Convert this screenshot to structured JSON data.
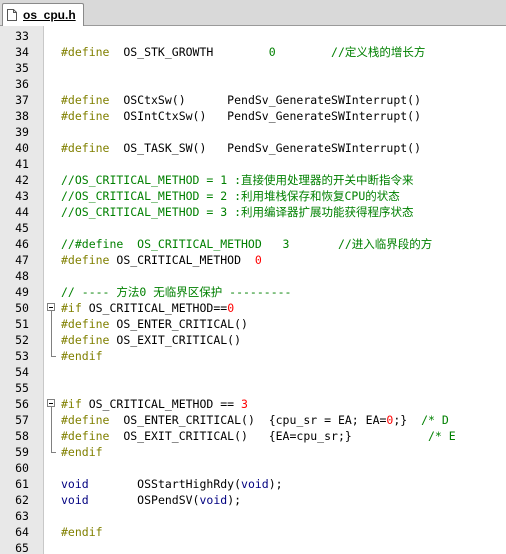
{
  "tab": {
    "label": "os_cpu.h",
    "icon": "file-icon"
  },
  "lines": [
    {
      "n": "33",
      "parts": []
    },
    {
      "n": "34",
      "parts": [
        [
          "kw",
          "#define"
        ],
        [
          "",
          "  OS_STK_GROWTH        "
        ],
        [
          "ct",
          "0"
        ],
        [
          "",
          "        "
        ],
        [
          "cm",
          "//定义栈的增长方"
        ]
      ]
    },
    {
      "n": "35",
      "parts": []
    },
    {
      "n": "36",
      "parts": []
    },
    {
      "n": "37",
      "parts": [
        [
          "kw",
          "#define"
        ],
        [
          "",
          "  OSCtxSw()      PendSv_GenerateSWInterrupt()"
        ]
      ]
    },
    {
      "n": "38",
      "parts": [
        [
          "kw",
          "#define"
        ],
        [
          "",
          "  OSIntCtxSw()   PendSv_GenerateSWInterrupt()"
        ]
      ]
    },
    {
      "n": "39",
      "parts": []
    },
    {
      "n": "40",
      "parts": [
        [
          "kw",
          "#define"
        ],
        [
          "",
          "  OS_TASK_SW()   PendSv_GenerateSWInterrupt()"
        ]
      ]
    },
    {
      "n": "41",
      "parts": []
    },
    {
      "n": "42",
      "parts": [
        [
          "cm",
          "//OS_CRITICAL_METHOD = 1 :直接使用处理器的开关中断指令来"
        ]
      ]
    },
    {
      "n": "43",
      "parts": [
        [
          "cm",
          "//OS_CRITICAL_METHOD = 2 :利用堆栈保存和恢复CPU的状态"
        ]
      ]
    },
    {
      "n": "44",
      "parts": [
        [
          "cm",
          "//OS_CRITICAL_METHOD = 3 :利用编译器扩展功能获得程序状态"
        ]
      ]
    },
    {
      "n": "45",
      "parts": []
    },
    {
      "n": "46",
      "parts": [
        [
          "cm",
          "//#define  OS_CRITICAL_METHOD   3       //进入临界段的方"
        ]
      ]
    },
    {
      "n": "47",
      "parts": [
        [
          "kw",
          "#define"
        ],
        [
          "",
          " OS_CRITICAL_METHOD  "
        ],
        [
          "nm",
          "0"
        ]
      ]
    },
    {
      "n": "48",
      "parts": []
    },
    {
      "n": "49",
      "parts": [
        [
          "cm",
          "// ---- 方法0 无临界区保护 ---------"
        ]
      ]
    },
    {
      "n": "50",
      "parts": [
        [
          "kw",
          "#if"
        ],
        [
          "",
          " OS_CRITICAL_METHOD=="
        ],
        [
          "nm",
          "0"
        ]
      ],
      "fold": "start"
    },
    {
      "n": "51",
      "parts": [
        [
          "kw",
          "#define"
        ],
        [
          "",
          " OS_ENTER_CRITICAL()"
        ]
      ]
    },
    {
      "n": "52",
      "parts": [
        [
          "kw",
          "#define"
        ],
        [
          "",
          " OS_EXIT_CRITICAL()"
        ]
      ]
    },
    {
      "n": "53",
      "parts": [
        [
          "kw",
          "#endif"
        ]
      ]
    },
    {
      "n": "54",
      "parts": []
    },
    {
      "n": "55",
      "parts": []
    },
    {
      "n": "56",
      "parts": [
        [
          "kw",
          "#if"
        ],
        [
          "",
          " OS_CRITICAL_METHOD == "
        ],
        [
          "nm",
          "3"
        ]
      ],
      "fold": "start"
    },
    {
      "n": "57",
      "parts": [
        [
          "kw",
          "#define"
        ],
        [
          "",
          "  OS_ENTER_CRITICAL()  {cpu_sr = EA; EA="
        ],
        [
          "nm",
          "0"
        ],
        [
          "",
          ";}  "
        ],
        [
          "cm",
          "/* D"
        ]
      ]
    },
    {
      "n": "58",
      "parts": [
        [
          "kw",
          "#define"
        ],
        [
          "",
          "  OS_EXIT_CRITICAL()   {EA=cpu_sr;}           "
        ],
        [
          "cm",
          "/* E"
        ]
      ]
    },
    {
      "n": "59",
      "parts": [
        [
          "kw",
          "#endif"
        ]
      ]
    },
    {
      "n": "60",
      "parts": []
    },
    {
      "n": "61",
      "parts": [
        [
          "ty",
          "void"
        ],
        [
          "",
          "       OSStartHighRdy("
        ],
        [
          "ty",
          "void"
        ],
        [
          "",
          ");"
        ]
      ]
    },
    {
      "n": "62",
      "parts": [
        [
          "ty",
          "void"
        ],
        [
          "",
          "       OSPendSV("
        ],
        [
          "ty",
          "void"
        ],
        [
          "",
          ");"
        ]
      ]
    },
    {
      "n": "63",
      "parts": []
    },
    {
      "n": "64",
      "parts": [
        [
          "kw",
          "#endif"
        ]
      ]
    },
    {
      "n": "65",
      "parts": []
    }
  ]
}
